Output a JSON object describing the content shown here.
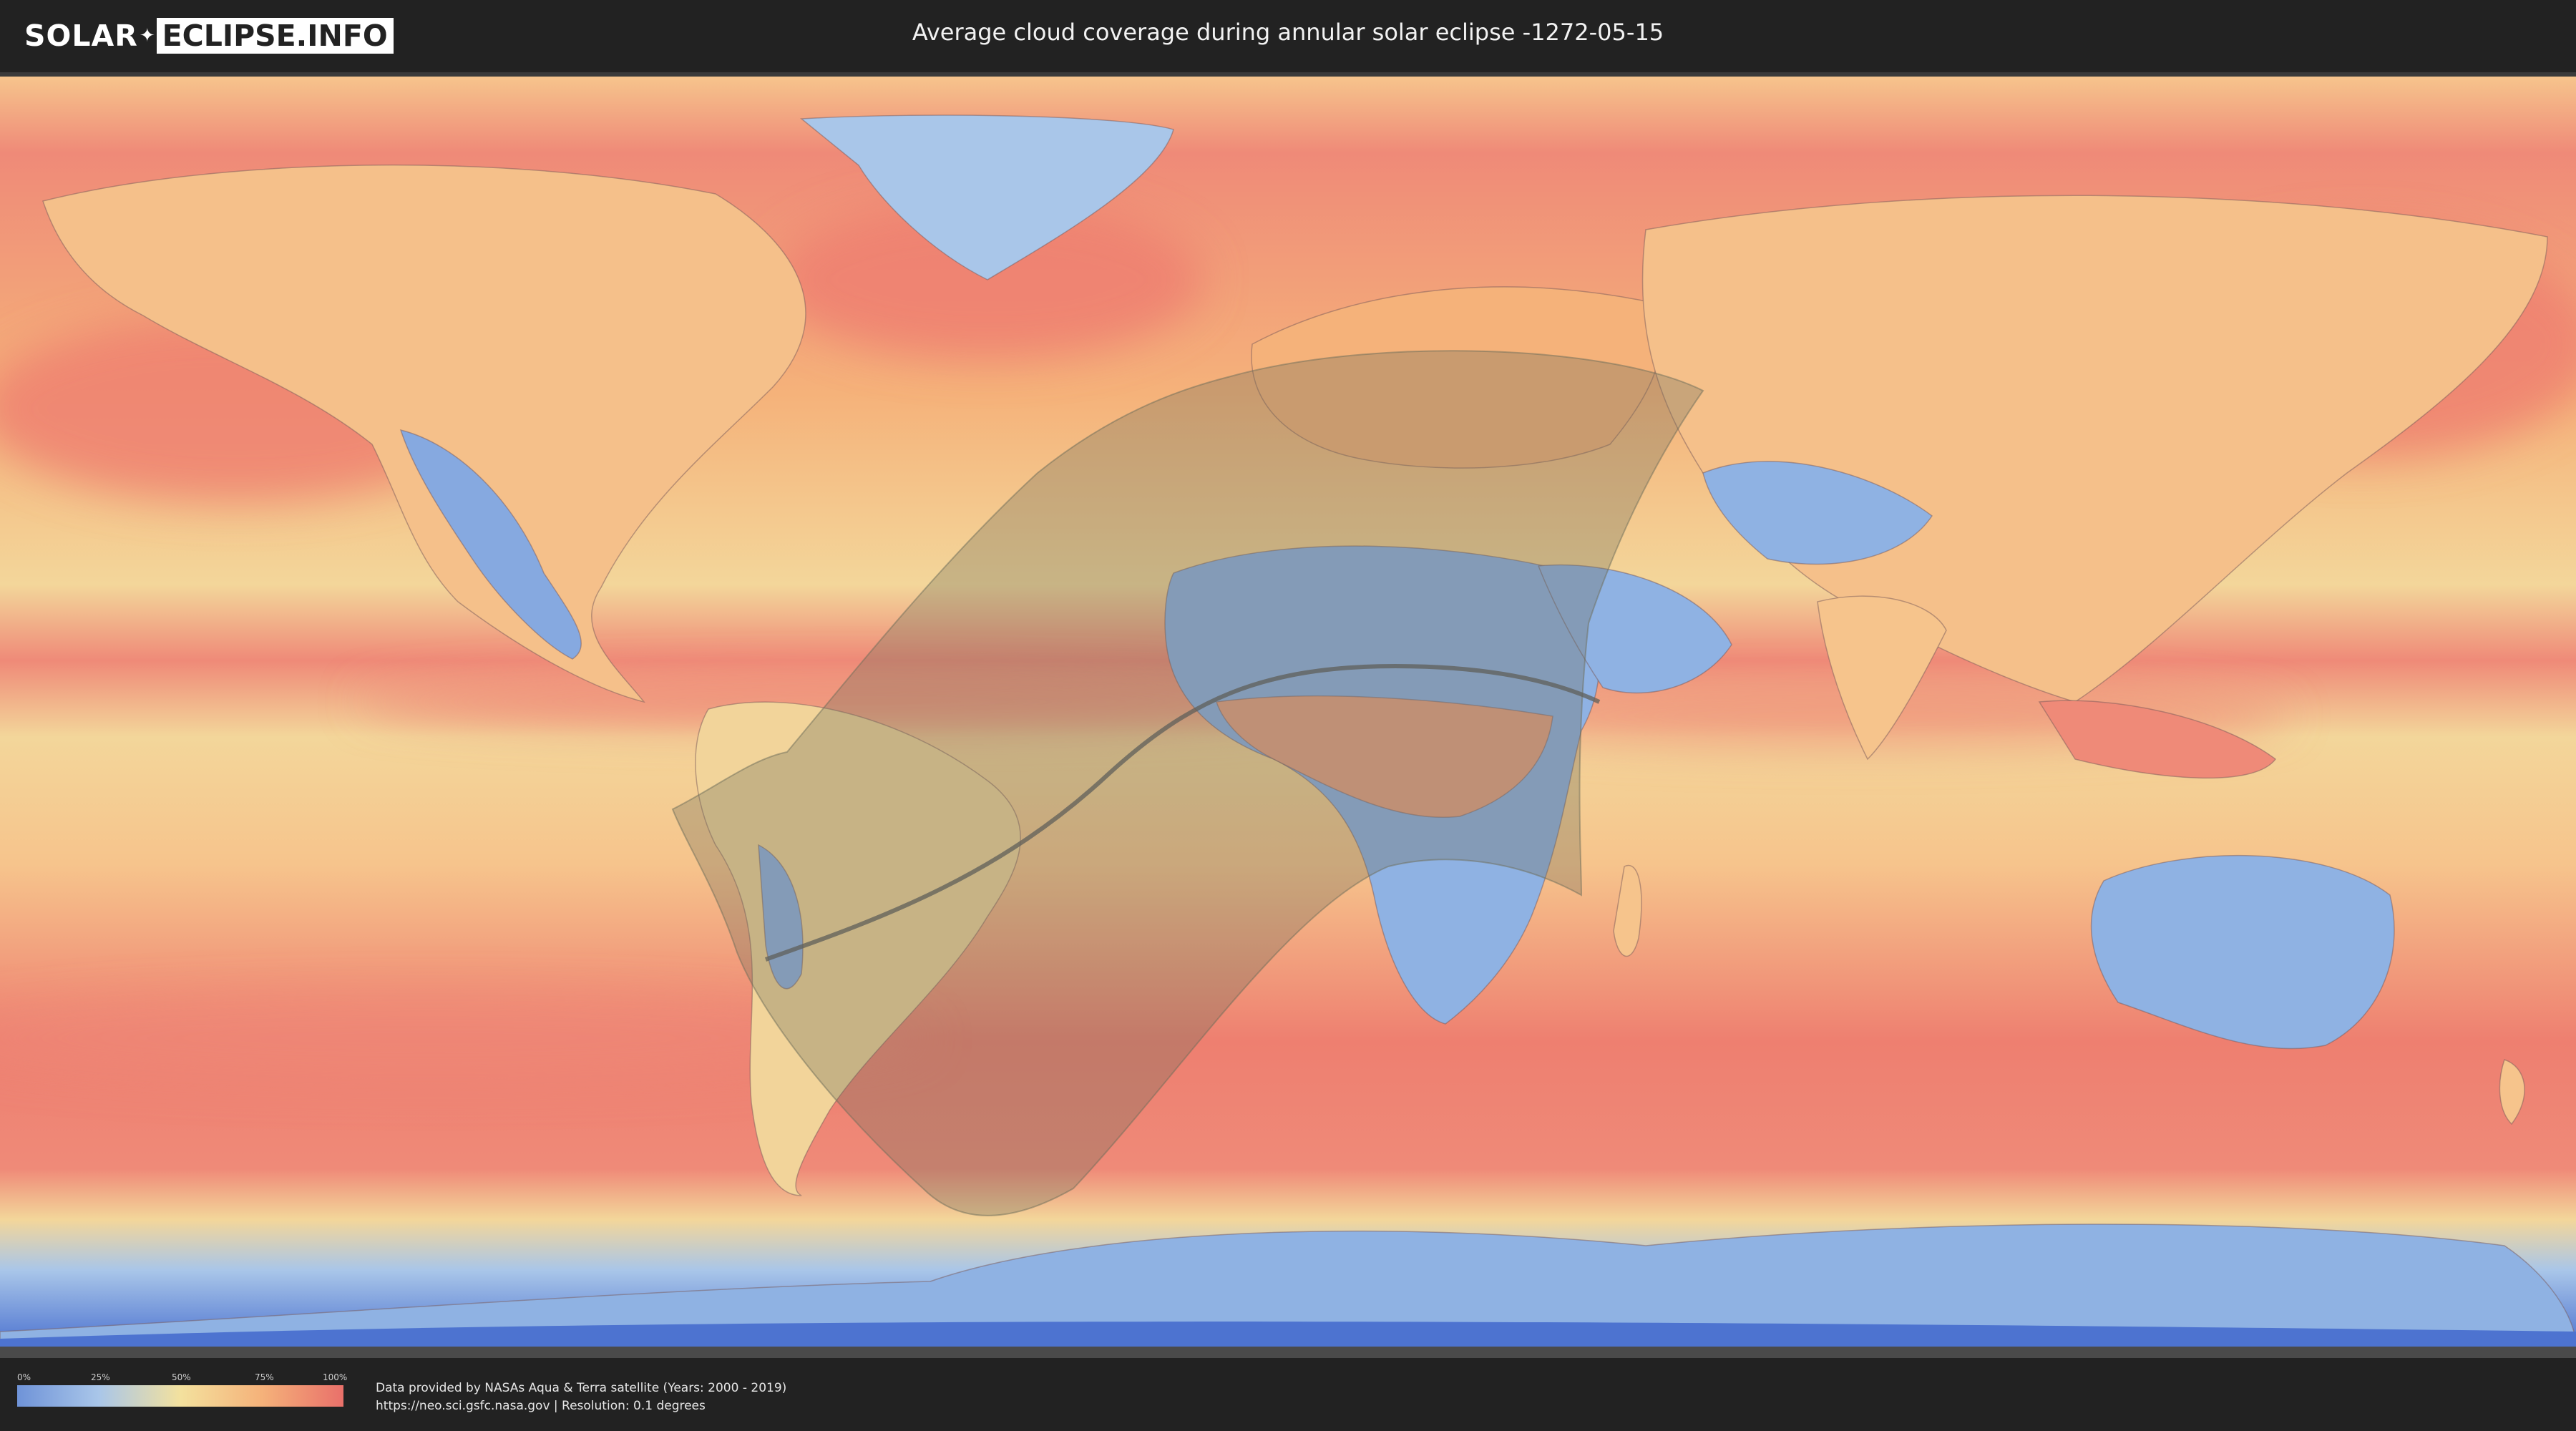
{
  "header": {
    "logo_left": "SOLAR",
    "logo_right": "ECLIPSE.INFO",
    "title": "Average cloud coverage during annular solar eclipse -1272-05-15"
  },
  "legend": {
    "ticks": [
      "0%",
      "25%",
      "50%",
      "75%",
      "100%"
    ],
    "colors": [
      "#6f93d8",
      "#a9c6e9",
      "#f3e19e",
      "#f5b27a",
      "#e9706a"
    ]
  },
  "credits": {
    "line1": "Data provided by NASAs Aqua & Terra satellite (Years: 2000 - 2019)",
    "line2": "https://neo.sci.gsfc.nasa.gov | Resolution: 0.1 degrees"
  },
  "map": {
    "colors": {
      "ocean_cloudy": "#ef8a78",
      "ocean_medium": "#f6c48c",
      "clear": "#8fb2e3",
      "path_shadow": "#6e6e5a"
    }
  }
}
